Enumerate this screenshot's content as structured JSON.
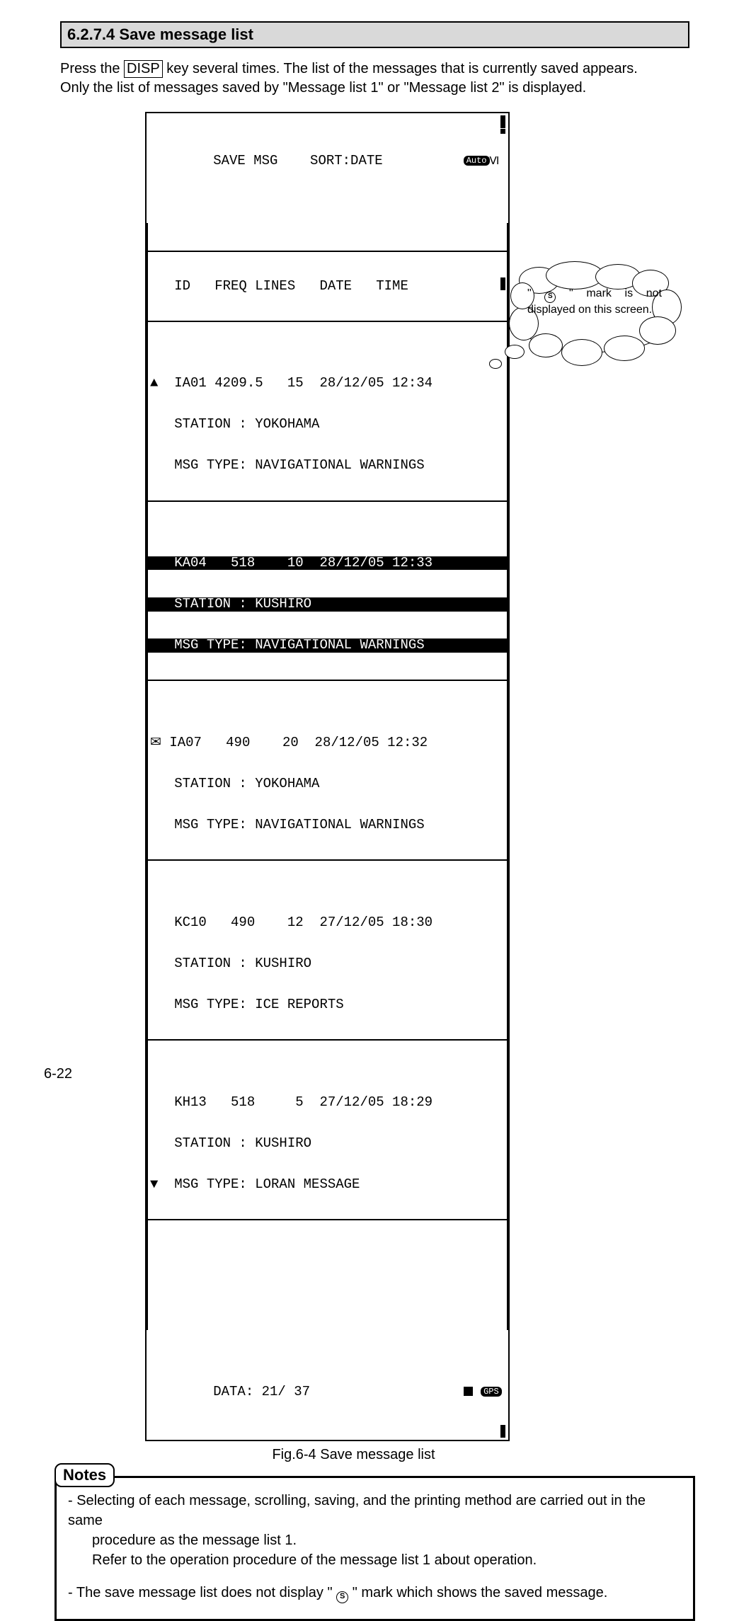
{
  "section": {
    "number": "6.2.7.4",
    "title": "Save message list"
  },
  "intro": {
    "line1_pre": "Press the ",
    "disp_key": "DISP",
    "line1_post": " key several times. The list of the messages that is currently saved appears.",
    "line2": "Only the list of messages saved by \"Message list 1\" or \"Message list 2\" is displayed."
  },
  "terminal": {
    "title_row": "SAVE MSG    SORT:DATE",
    "auto_badge": "Auto",
    "roman_six": "Ⅵ",
    "header_row": "   ID   FREQ LINES   DATE   TIME",
    "rows": [
      {
        "inv": false,
        "l1": "  IA01 4209.5   15  28/12/05 12:34",
        "l2": "  STATION : YOKOHAMA",
        "l3": "  MSG TYPE: NAVIGATIONAL WARNINGS"
      },
      {
        "inv": true,
        "l1": "  KA04   518    10  28/12/05 12:33",
        "l2": "  STATION : KUSHIRO",
        "l3": "  MSG TYPE: NAVIGATIONAL WARNINGS"
      },
      {
        "inv": false,
        "l1": " IA07   490    20  28/12/05 12:32",
        "l2": "  STATION : YOKOHAMA",
        "l3": "  MSG TYPE: NAVIGATIONAL WARNINGS"
      },
      {
        "inv": false,
        "l1": "  KC10   490    12  27/12/05 18:30",
        "l2": "  STATION : KUSHIRO",
        "l3": "  MSG TYPE: ICE REPORTS"
      },
      {
        "inv": false,
        "l1": "  KH13   518     5  27/12/05 18:29",
        "l2": "  STATION : KUSHIRO",
        "l3": "  MSG TYPE: LORAN MESSAGE"
      }
    ],
    "footer_row": "DATA: 21/ 37",
    "gps_badge": "GPS",
    "chart_data": {
      "type": "table",
      "title": "SAVE MSG  SORT:DATE",
      "columns": [
        "ID",
        "FREQ",
        "LINES",
        "DATE",
        "TIME",
        "STATION",
        "MSG TYPE"
      ],
      "rows": [
        [
          "IA01",
          "4209.5",
          15,
          "28/12/05",
          "12:34",
          "YOKOHAMA",
          "NAVIGATIONAL WARNINGS"
        ],
        [
          "KA04",
          "518",
          10,
          "28/12/05",
          "12:33",
          "KUSHIRO",
          "NAVIGATIONAL WARNINGS"
        ],
        [
          "IA07",
          "490",
          20,
          "28/12/05",
          "12:32",
          "YOKOHAMA",
          "NAVIGATIONAL WARNINGS"
        ],
        [
          "KC10",
          "490",
          12,
          "27/12/05",
          "18:30",
          "KUSHIRO",
          "ICE REPORTS"
        ],
        [
          "KH13",
          "518",
          5,
          "27/12/05",
          "18:29",
          "KUSHIRO",
          "LORAN MESSAGE"
        ]
      ],
      "footer": "DATA: 21/ 37"
    }
  },
  "figure_caption": "Fig.6-4 Save message list",
  "callout": {
    "quote_open": "\" ",
    "mark_glyph": "S",
    "text_after_mark": " \" mark is not displayed on this screen."
  },
  "notes": {
    "label": "Notes",
    "item1_line1": "- Selecting of each message, scrolling, saving, and the printing method are carried out in the same",
    "item1_line2": "procedure as the message list 1.",
    "item1_line3": "Refer to the operation procedure of the message list 1 about operation.",
    "item2_pre": "- The save message list does not display \" ",
    "item2_mark_glyph": "S",
    "item2_post": " \" mark which shows the saved message."
  },
  "page_number": "6-22"
}
